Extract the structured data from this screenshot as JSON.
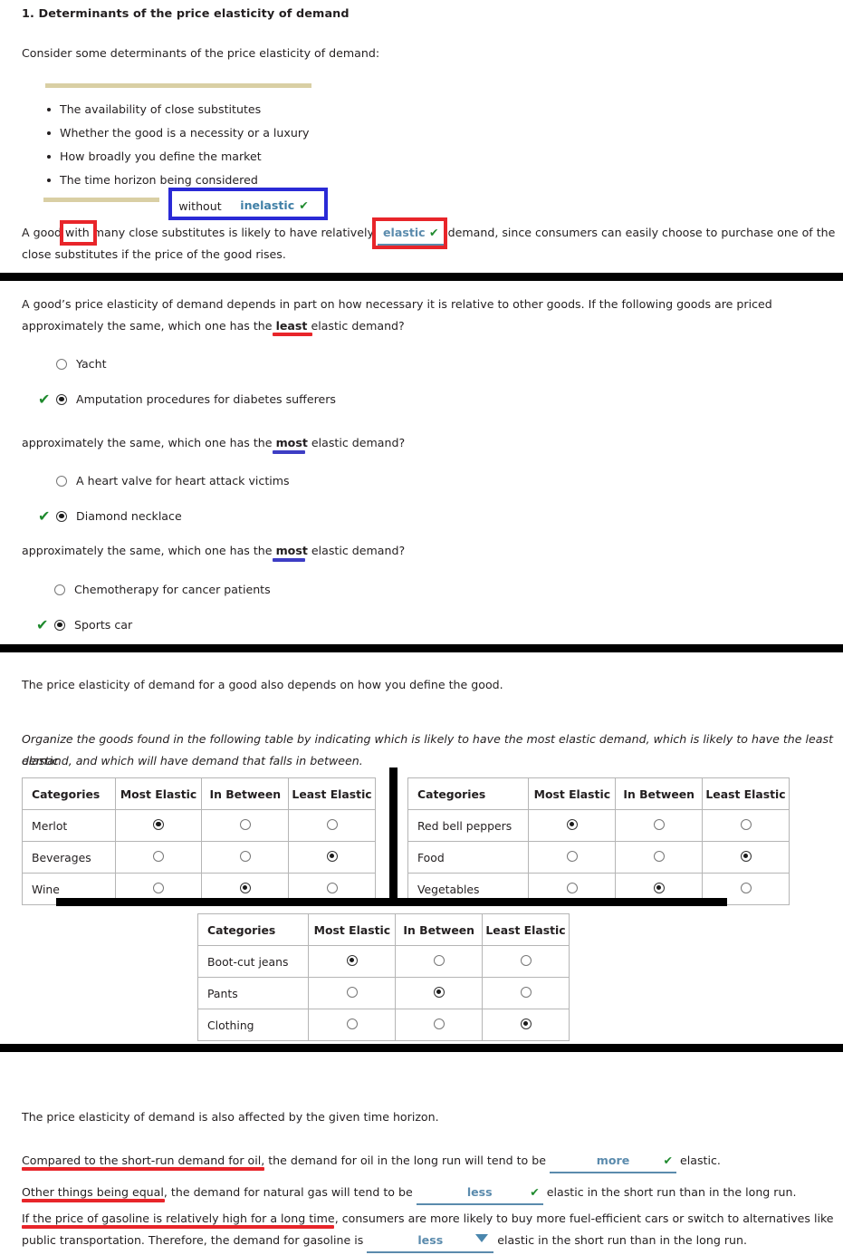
{
  "question": {
    "number_title": "1. Determinants of the price elasticity of demand",
    "intro": "Consider some determinants of the price elasticity of demand:"
  },
  "determinants": [
    "The availability of close substitutes",
    "Whether the good is a necessity or a luxury",
    "How broadly you define the market",
    "The time horizon being considered"
  ],
  "widget": {
    "left_label": "without",
    "answer_label": "inelastic",
    "check_glyph": "✔"
  },
  "substitutes_sentence": {
    "part1": "A good",
    "highlight": "with",
    "part2": "many close substitutes is likely to have relatively",
    "answer": "elastic",
    "check_glyph": "✔",
    "part3": "demand, since consumers can easily choose to purchase one of the",
    "line2": "close substitutes if the price of the good rises."
  },
  "necessity": {
    "prompt_line1": "A good’s price elasticity of demand depends in part on how necessary it is relative to other goods. If the following goods are priced",
    "prompt_line2_pre": "approximately the same, which one has the",
    "prompt_line2_bold": "least",
    "prompt_line2_post": "elastic demand?",
    "groups": [
      {
        "prompt_pre": "",
        "prompt_bold": "",
        "prompt_post": "",
        "options": [
          {
            "label": "Yacht",
            "selected": false,
            "correct": false
          },
          {
            "label": "Amputation procedures for diabetes sufferers",
            "selected": true,
            "correct": true
          }
        ]
      },
      {
        "prompt_pre": "approximately the same, which one has the",
        "prompt_bold": "most",
        "prompt_post": "elastic demand?",
        "options": [
          {
            "label": "A heart valve for heart attack victims",
            "selected": false,
            "correct": false
          },
          {
            "label": "Diamond necklace",
            "selected": true,
            "correct": true
          }
        ]
      },
      {
        "prompt_pre": "approximately the same, which one has the",
        "prompt_bold": "most",
        "prompt_post": "elastic demand?",
        "options": [
          {
            "label": "Chemotherapy for cancer patients",
            "selected": false,
            "correct": false
          },
          {
            "label": "Sports car",
            "selected": true,
            "correct": true
          }
        ]
      }
    ],
    "check_glyph": "✔"
  },
  "definition": {
    "intro": "The price elasticity of demand for a good also depends on how you define the good.",
    "instruction_line1": "Organize the goods found in the following table by indicating which is likely to have the most elastic demand, which is likely to have the least elastic",
    "instruction_line2": "demand, and which will have demand that falls in between."
  },
  "tables": {
    "headers": [
      "Categories",
      "Most Elastic",
      "In Between",
      "Least Elastic"
    ],
    "table1": {
      "rows": [
        {
          "category": "Merlot",
          "selected": 0
        },
        {
          "category": "Beverages",
          "selected": 2
        },
        {
          "category": "Wine",
          "selected": 1
        }
      ]
    },
    "table2": {
      "rows": [
        {
          "category": "Red bell peppers",
          "selected": 0
        },
        {
          "category": "Food",
          "selected": 2
        },
        {
          "category": "Vegetables",
          "selected": 1
        }
      ]
    },
    "table3": {
      "rows": [
        {
          "category": "Boot-cut jeans",
          "selected": 0
        },
        {
          "category": "Pants",
          "selected": 1
        },
        {
          "category": "Clothing",
          "selected": 2
        }
      ]
    }
  },
  "time_horizon": {
    "intro": "The price elasticity of demand is also affected by the given time horizon.",
    "s1_pre": "Compared to the short-run demand for oil",
    "s1_mid": ", the demand for oil in the long run will tend to be",
    "s1_answer": "more",
    "s1_post": "elastic.",
    "s2_pre": "Other things being equal",
    "s2_mid": ", the demand for natural gas will tend to be",
    "s2_answer": "less",
    "s2_post": "elastic in the short run than in the long run.",
    "s3_pre": "If the price of gasoline is relatively high for a long time",
    "s3_mid": ", consumers are more likely to buy more fuel-efficient cars or switch to alternatives like",
    "s3_line2_pre": "public transportation. Therefore, the demand for gasoline is",
    "s3_answer": "less",
    "s3_post": "elastic in the short run than in the long run.",
    "check_glyph": "✔"
  },
  "colors": {
    "annotation_red": "#e8252a",
    "annotation_blue": "#2a2ad6",
    "answer_blue": "#5b8bad",
    "check_green": "#1f8a2e",
    "tan_rule": "#d9cfa4"
  }
}
